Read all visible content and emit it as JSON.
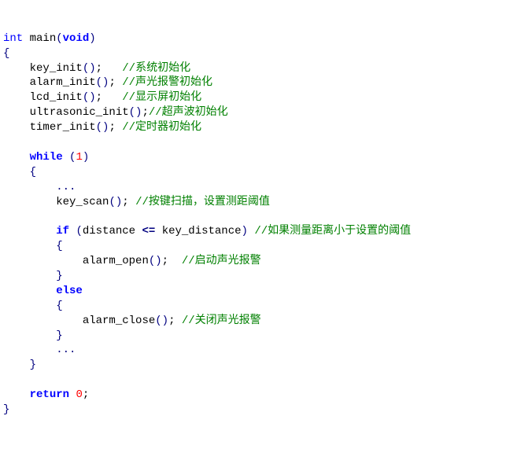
{
  "code": {
    "ty_int": "int",
    "fn_main": "main",
    "ty_void": "void",
    "lbrace": "{",
    "rbrace": "}",
    "lparen": "(",
    "rparen": ")",
    "semi": ";",
    "dots": "...",
    "call_key_init": "key_init",
    "cm_sys_init": "//系统初始化",
    "call_alarm_init": "alarm_init",
    "cm_alarm_init": "//声光报警初始化",
    "call_lcd_init": "lcd_init",
    "cm_lcd_init": "//显示屏初始化",
    "call_ultra_init": "ultrasonic_init",
    "cm_ultra_init": "//超声波初始化",
    "call_timer_init": "timer_init",
    "cm_timer_init": "//定时器初始化",
    "kw_while": "while",
    "num_1": "1",
    "call_key_scan": "key_scan",
    "cm_key_scan": "//按键扫描，设置测距阈值",
    "kw_if": "if",
    "id_distance": "distance",
    "op_le": "<=",
    "id_key_distance": "key_distance",
    "cm_if": "//如果测量距离小于设置的阈值",
    "call_alarm_open": "alarm_open",
    "cm_alarm_open": "//启动声光报警",
    "kw_else": "else",
    "call_alarm_close": "alarm_close",
    "cm_alarm_close": "//关闭声光报警",
    "kw_return": "return",
    "num_0": "0"
  }
}
